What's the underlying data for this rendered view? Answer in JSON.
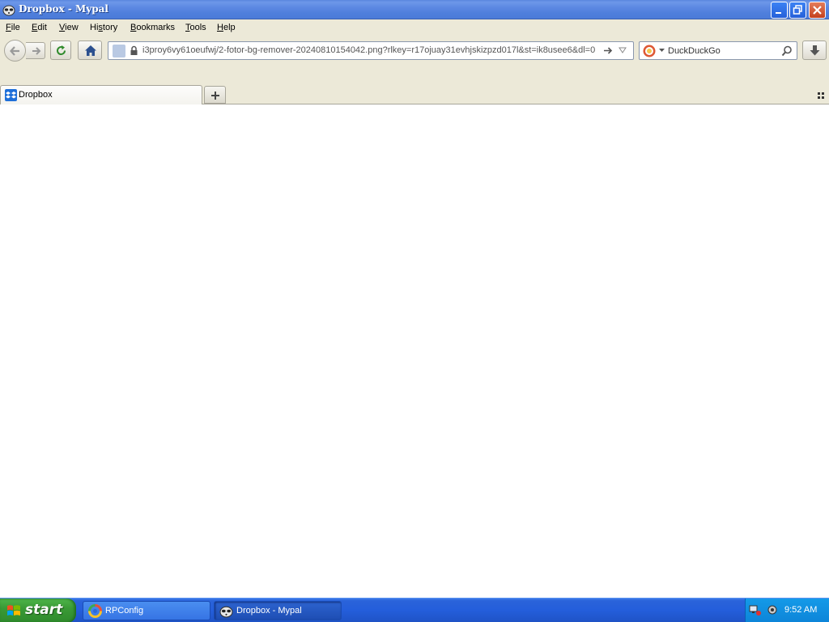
{
  "window": {
    "title": "Dropbox - Mypal",
    "controls": {
      "minimize": "minimize-icon",
      "maximize": "restore-icon",
      "close": "close-icon"
    }
  },
  "menu": {
    "items": [
      {
        "label": "File",
        "accel": "F"
      },
      {
        "label": "Edit",
        "accel": "E"
      },
      {
        "label": "View",
        "accel": "V"
      },
      {
        "label": "History",
        "accel": "s"
      },
      {
        "label": "Bookmarks",
        "accel": "B"
      },
      {
        "label": "Tools",
        "accel": "T"
      },
      {
        "label": "Help",
        "accel": "H"
      }
    ]
  },
  "navbar": {
    "url": "i3proy6vy61oeufwj/2-fotor-bg-remover-20240810154042.png?rlkey=r17ojuay31evhjskizpzd017l&st=ik8usee6&dl=0",
    "search_engine": "DuckDuckGo",
    "icons": [
      "back-icon",
      "forward-icon",
      "reload-icon",
      "home-icon",
      "lock-icon",
      "go-arrow-icon",
      "search-icon",
      "download-icon"
    ]
  },
  "tabs": [
    {
      "label": "Dropbox",
      "active": true
    }
  ],
  "taskbar": {
    "start_label": "start",
    "items": [
      {
        "label": "RPConfig",
        "active": false
      },
      {
        "label": "Dropbox - Mypal",
        "active": true
      }
    ],
    "clock": "9:52 AM"
  },
  "colors": {
    "titlebar": "#4f7fdc",
    "chrome": "#ece9d8",
    "taskbar": "#245edb",
    "start": "#3a9a36",
    "tray": "#0d84d8",
    "dropbox_blue": "#1e6fd9"
  }
}
